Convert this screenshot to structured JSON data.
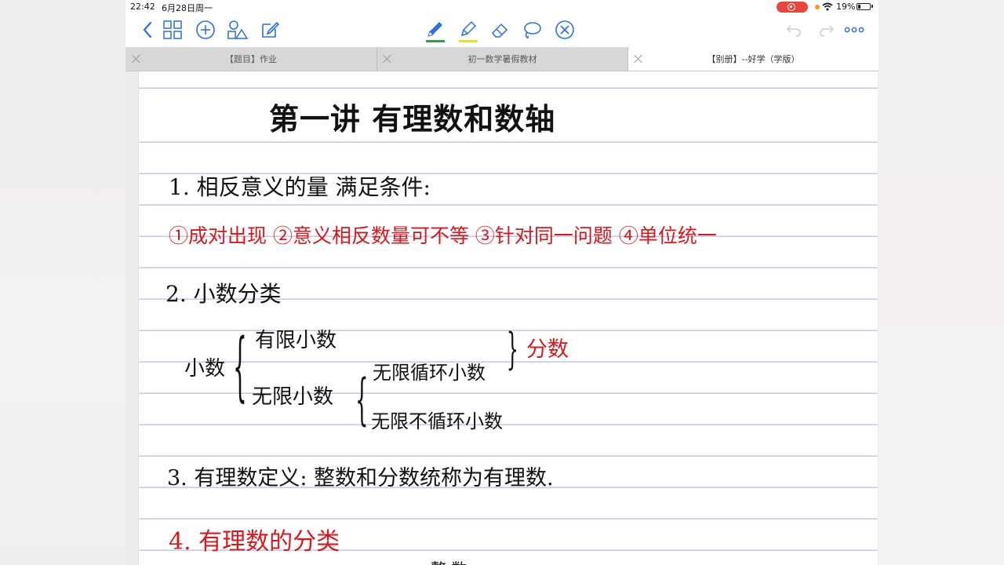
{
  "status": {
    "time": "22:42",
    "date": "6月28日周一",
    "battery": "19%",
    "battery_level": 0.19,
    "colors": {
      "record": "#e8463c",
      "mic_dot": "#f29b1a"
    }
  },
  "toolbar": {
    "left_icons": [
      "chevron-left-icon",
      "grid-icon",
      "plus-circle-icon",
      "shapes-icon",
      "edit-icon"
    ],
    "tools": [
      {
        "name": "pen-icon",
        "underline": "#2fa33b"
      },
      {
        "name": "highlighter-icon",
        "underline": "#e6e22a"
      },
      {
        "name": "eraser-icon"
      },
      {
        "name": "lasso-icon"
      },
      {
        "name": "close-circle-icon"
      }
    ],
    "right_icons": [
      "undo-icon",
      "redo-icon",
      "more-icon"
    ],
    "accent": "#2a6fdb"
  },
  "tabs": [
    {
      "label": "【题目】作业",
      "active": false
    },
    {
      "label": "初一数学暑假教材",
      "active": false
    },
    {
      "label": "【别册】--好学（学版）",
      "active": true
    }
  ],
  "note": {
    "title": "第一讲    有理数和数轴",
    "s1_heading": "1. 相反意义的量 满足条件:",
    "s1_conditions": "①成对出现  ②意义相反数量可不等  ③针对同一问题  ④单位统一",
    "s2_heading": "2. 小数分类",
    "tree": {
      "root": "小数",
      "finite": "有限小数",
      "infinite": "无限小数",
      "repeating": "无限循环小数",
      "non_repeating": "无限不循环小数",
      "fraction_label": "分数"
    },
    "s3": "3. 有理数定义: 整数和分数统称为有理数.",
    "s4_heading": "4. 有理数的分类",
    "s4_partial": "整 数"
  }
}
